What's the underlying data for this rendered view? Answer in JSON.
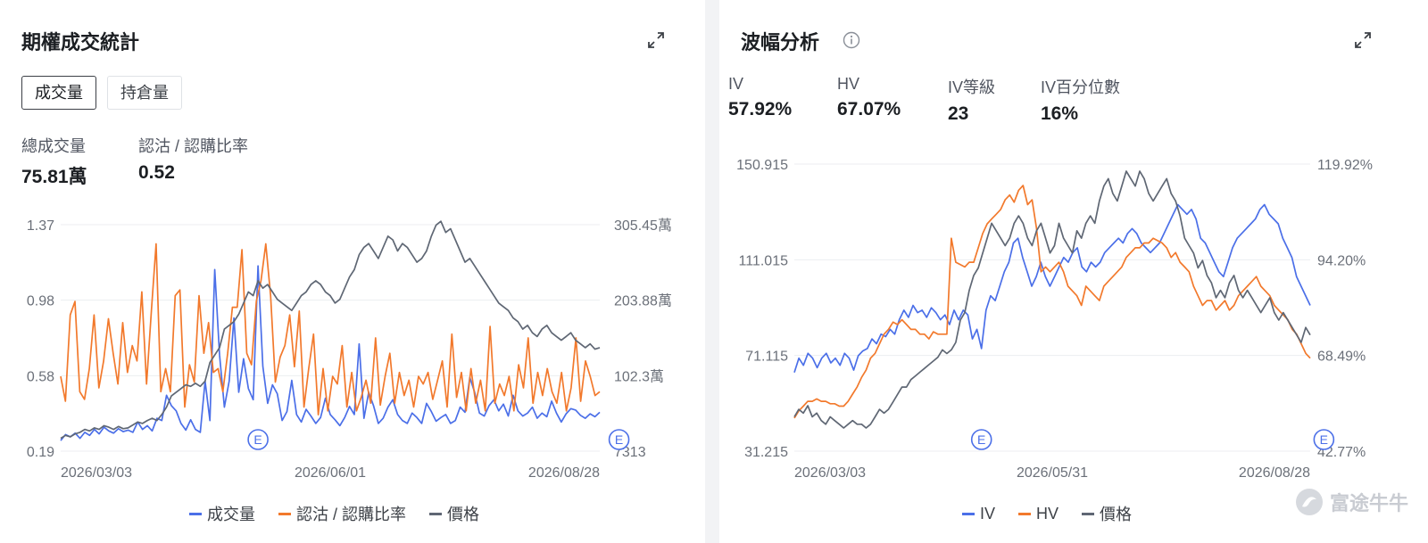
{
  "panel1": {
    "title": "期權成交統計",
    "tabs": [
      {
        "label": "成交量",
        "active": true
      },
      {
        "label": "持倉量",
        "active": false
      }
    ],
    "stats": [
      {
        "label": "總成交量",
        "value": "75.81萬"
      },
      {
        "label": "認沽 / 認購比率",
        "value": "0.52"
      }
    ],
    "legend": [
      {
        "label": "成交量",
        "color": "#4b6fe8"
      },
      {
        "label": "認沽 / 認購比率",
        "color": "#f2792c"
      },
      {
        "label": "價格",
        "color": "#5f6774"
      }
    ]
  },
  "panel2": {
    "title": "波幅分析",
    "stats": [
      {
        "label": "IV",
        "value": "57.92%"
      },
      {
        "label": "HV",
        "value": "67.07%"
      },
      {
        "label": "IV等級",
        "value": "23"
      },
      {
        "label": "IV百分位數",
        "value": "16%"
      }
    ],
    "legend": [
      {
        "label": "IV",
        "color": "#4b6fe8"
      },
      {
        "label": "HV",
        "color": "#f2792c"
      },
      {
        "label": "價格",
        "color": "#5f6774"
      }
    ]
  },
  "watermark": "富途牛牛",
  "chart_data": [
    {
      "type": "line",
      "left_ticks": [
        "1.37",
        "0.98",
        "0.58",
        "0.19"
      ],
      "right_ticks": [
        "305.45萬",
        "203.88萬",
        "102.3萬",
        "7313"
      ],
      "x_ticks": [
        "2026/03/03",
        "2026/06/01",
        "2026/08/28"
      ],
      "event_markers": [
        {
          "label": "E",
          "x": 41
        },
        {
          "label": "E",
          "x": 116
        }
      ],
      "series": [
        {
          "name": "成交量",
          "color": "#4b6fe8",
          "axis": "right",
          "values": [
            150000,
            230000,
            200000,
            250000,
            180000,
            260000,
            220000,
            300000,
            240000,
            330000,
            280000,
            250000,
            310000,
            270000,
            290000,
            260000,
            400000,
            300000,
            350000,
            280000,
            450000,
            420000,
            760000,
            620000,
            550000,
            380000,
            290000,
            430000,
            300000,
            260000,
            950000,
            420000,
            2450000,
            1300000,
            600000,
            950000,
            1800000,
            800000,
            1250000,
            850000,
            700000,
            2500000,
            1150000,
            650000,
            900000,
            780000,
            420000,
            540000,
            960000,
            500000,
            400000,
            570000,
            480000,
            380000,
            460000,
            720000,
            500000,
            430000,
            350000,
            460000,
            610000,
            500000,
            1450000,
            450000,
            800000,
            620000,
            380000,
            450000,
            600000,
            700000,
            500000,
            420000,
            380000,
            520000,
            460000,
            380000,
            650000,
            540000,
            410000,
            460000,
            500000,
            380000,
            420000,
            600000,
            530000,
            1000000,
            800000,
            520000,
            480000,
            620000,
            700000,
            550000,
            640000,
            480000,
            760000,
            550000,
            480000,
            520000,
            600000,
            450000,
            520000,
            470000,
            680000,
            520000,
            400000,
            510000,
            580000,
            560000,
            490000,
            450000,
            510000,
            470000,
            530000
          ]
        },
        {
          "name": "認沽 / 認購比率",
          "color": "#f2792c",
          "axis": "left",
          "values": [
            0.58,
            0.45,
            0.9,
            0.97,
            0.5,
            0.46,
            0.62,
            0.9,
            0.52,
            0.66,
            0.88,
            0.7,
            0.54,
            0.86,
            0.6,
            0.74,
            0.66,
            1.02,
            0.54,
            0.92,
            1.27,
            0.5,
            0.62,
            0.5,
            1.0,
            1.03,
            0.42,
            0.64,
            0.55,
            1.0,
            0.7,
            0.86,
            0.6,
            0.62,
            0.5,
            0.7,
            0.94,
            0.94,
            1.24,
            0.7,
            0.64,
            0.97,
            1.08,
            1.27,
            1.0,
            0.55,
            0.68,
            0.74,
            0.9,
            0.63,
            0.92,
            0.42,
            0.62,
            0.8,
            0.38,
            0.62,
            0.4,
            0.58,
            0.54,
            0.74,
            0.42,
            0.6,
            0.4,
            0.47,
            0.56,
            0.44,
            0.78,
            0.43,
            0.58,
            0.7,
            0.44,
            0.6,
            0.48,
            0.56,
            0.42,
            0.58,
            0.54,
            0.6,
            0.46,
            0.56,
            0.66,
            0.42,
            0.8,
            0.47,
            0.6,
            0.4,
            0.62,
            0.44,
            0.56,
            0.4,
            0.84,
            0.44,
            0.54,
            0.48,
            0.58,
            0.4,
            0.64,
            0.52,
            0.78,
            0.44,
            0.6,
            0.48,
            0.62,
            0.5,
            0.44,
            0.6,
            0.4,
            0.52,
            0.78,
            0.45,
            0.66,
            0.58,
            0.48,
            0.5
          ]
        },
        {
          "name": "價格",
          "color": "#5f6774",
          "axis": "right",
          "values": [
            180000,
            220000,
            200000,
            240000,
            260000,
            300000,
            280000,
            320000,
            300000,
            350000,
            330000,
            300000,
            340000,
            310000,
            320000,
            360000,
            400000,
            380000,
            420000,
            450000,
            420000,
            500000,
            600000,
            750000,
            800000,
            850000,
            900000,
            880000,
            920000,
            880000,
            950000,
            1200000,
            1300000,
            1400000,
            1650000,
            1700000,
            1750000,
            1850000,
            2000000,
            2150000,
            2100000,
            2300000,
            2200000,
            2250000,
            2150000,
            2050000,
            2000000,
            1950000,
            1900000,
            2000000,
            2100000,
            2150000,
            2250000,
            2300000,
            2250000,
            2150000,
            2100000,
            2000000,
            2050000,
            2200000,
            2350000,
            2450000,
            2650000,
            2750000,
            2800000,
            2700000,
            2600000,
            2750000,
            2900000,
            2850000,
            2700000,
            2800000,
            2750000,
            2650000,
            2550000,
            2600000,
            2700000,
            2900000,
            3050000,
            3100000,
            2950000,
            3000000,
            2850000,
            2700000,
            2550000,
            2600000,
            2500000,
            2400000,
            2300000,
            2200000,
            2100000,
            2000000,
            1950000,
            1900000,
            1800000,
            1750000,
            1650000,
            1700000,
            1600000,
            1550000,
            1650000,
            1700000,
            1600000,
            1550000,
            1500000,
            1550000,
            1600000,
            1500000,
            1450000,
            1400000,
            1450000,
            1380000,
            1400000
          ]
        }
      ]
    },
    {
      "type": "line",
      "left_ticks": [
        "150.915",
        "111.015",
        "71.115",
        "31.215"
      ],
      "right_ticks": [
        "119.92%",
        "94.20%",
        "68.49%",
        "42.77%"
      ],
      "x_ticks": [
        "2026/03/03",
        "2026/05/31",
        "2026/08/28"
      ],
      "event_markers": [
        {
          "label": "E",
          "x": 41
        },
        {
          "label": "E",
          "x": 116
        }
      ],
      "series": [
        {
          "name": "IV",
          "color": "#4b6fe8",
          "axis": "left",
          "values": [
            64,
            70,
            67,
            72,
            70,
            66,
            70,
            72,
            68,
            70,
            67,
            72,
            70,
            65,
            71,
            73,
            74,
            78,
            76,
            80,
            79,
            82,
            80,
            86,
            90,
            87,
            92,
            89,
            90,
            87,
            91,
            89,
            86,
            88,
            84,
            90,
            86,
            90,
            88,
            78,
            82,
            74,
            90,
            96,
            94,
            100,
            106,
            110,
            118,
            120,
            112,
            106,
            100,
            104,
            110,
            104,
            100,
            104,
            108,
            112,
            110,
            114,
            116,
            108,
            106,
            110,
            108,
            110,
            114,
            116,
            118,
            120,
            118,
            122,
            124,
            122,
            118,
            116,
            114,
            116,
            118,
            122,
            126,
            130,
            134,
            132,
            130,
            132,
            128,
            120,
            118,
            114,
            110,
            106,
            104,
            110,
            116,
            120,
            122,
            124,
            126,
            128,
            132,
            134,
            130,
            128,
            126,
            120,
            116,
            112,
            104,
            100,
            96,
            92
          ]
        },
        {
          "name": "HV",
          "color": "#f2792c",
          "axis": "left",
          "values": [
            45,
            48,
            50,
            52,
            52,
            53,
            52,
            52,
            51,
            51,
            50,
            50,
            52,
            55,
            58,
            62,
            65,
            70,
            72,
            76,
            80,
            82,
            85,
            84,
            86,
            84,
            82,
            82,
            80,
            80,
            78,
            81,
            80,
            80,
            80,
            120,
            110,
            109,
            108,
            110,
            110,
            116,
            122,
            126,
            128,
            130,
            132,
            136,
            138,
            135,
            140,
            142,
            134,
            136,
            124,
            106,
            108,
            106,
            108,
            110,
            106,
            100,
            98,
            96,
            92,
            100,
            98,
            96,
            94,
            100,
            102,
            104,
            106,
            108,
            112,
            114,
            116,
            116,
            118,
            118,
            120,
            119,
            118,
            116,
            112,
            114,
            110,
            108,
            106,
            100,
            96,
            92,
            94,
            94,
            90,
            92,
            94,
            90,
            92,
            96,
            98,
            100,
            102,
            104,
            100,
            98,
            96,
            92,
            90,
            88,
            86,
            82,
            80,
            76,
            72,
            70
          ]
        },
        {
          "name": "價格",
          "color": "#5f6774",
          "axis": "right",
          "values": [
            52,
            54,
            53,
            55,
            52,
            53,
            51,
            50,
            52,
            51,
            50,
            49,
            50,
            51,
            50,
            50,
            49,
            50,
            52,
            54,
            53,
            54,
            56,
            58,
            60,
            60,
            62,
            63,
            64,
            65,
            66,
            67,
            68,
            70,
            69,
            70,
            72,
            78,
            80,
            86,
            90,
            92,
            96,
            100,
            104,
            102,
            100,
            98,
            100,
            104,
            106,
            104,
            100,
            98,
            102,
            104,
            100,
            96,
            98,
            104,
            100,
            98,
            96,
            102,
            100,
            104,
            106,
            104,
            110,
            114,
            116,
            112,
            110,
            114,
            118,
            116,
            114,
            118,
            116,
            112,
            110,
            112,
            114,
            116,
            112,
            110,
            106,
            100,
            98,
            96,
            92,
            94,
            90,
            88,
            84,
            86,
            84,
            88,
            90,
            86,
            84,
            86,
            84,
            82,
            80,
            82,
            84,
            80,
            78,
            80,
            78,
            76,
            74,
            72,
            76,
            74
          ]
        }
      ]
    }
  ]
}
